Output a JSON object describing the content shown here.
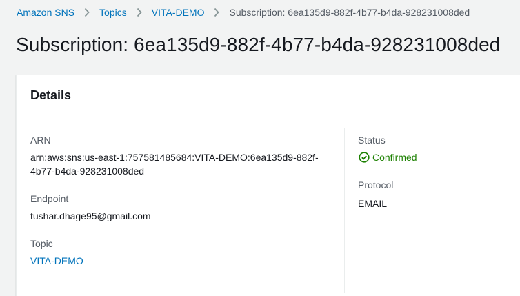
{
  "breadcrumb": {
    "items": [
      {
        "label": "Amazon SNS"
      },
      {
        "label": "Topics"
      },
      {
        "label": "VITA-DEMO"
      },
      {
        "label": "Subscription: 6ea135d9-882f-4b77-b4da-928231008ded"
      }
    ]
  },
  "page": {
    "title": "Subscription: 6ea135d9-882f-4b77-b4da-928231008ded"
  },
  "details": {
    "title": "Details",
    "arn": {
      "label": "ARN",
      "value_line1": "arn:aws:sns:us-east-1:757581485684:VITA-DEMO:6ea135d9-882f-",
      "value_line2": "4b77-b4da-928231008ded"
    },
    "endpoint": {
      "label": "Endpoint",
      "value": "tushar.dhage95@gmail.com"
    },
    "topic": {
      "label": "Topic",
      "value": "VITA-DEMO"
    },
    "status": {
      "label": "Status",
      "value": "Confirmed",
      "icon": "check-circle-icon",
      "color": "#1d8102"
    },
    "protocol": {
      "label": "Protocol",
      "value": "EMAIL"
    }
  },
  "colors": {
    "link": "#0073bb",
    "label": "#545b64",
    "text": "#16191f",
    "background": "#f2f3f3",
    "success": "#1d8102"
  }
}
